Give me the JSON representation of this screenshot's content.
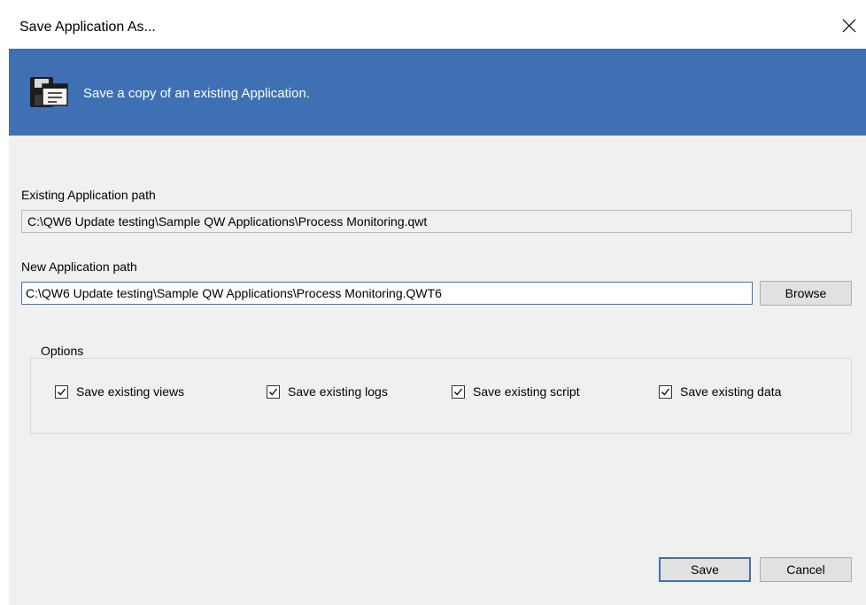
{
  "window": {
    "title": "Save Application As...",
    "close_icon": "close-icon"
  },
  "banner": {
    "icon": "save-application-icon",
    "text": "Save a copy of an existing Application.",
    "background": "#3f70b4"
  },
  "existing_path": {
    "label": "Existing Application path",
    "value": "C:\\QW6 Update testing\\Sample QW Applications\\Process Monitoring.qwt"
  },
  "new_path": {
    "label": "New Application path",
    "value": "C:\\QW6 Update testing\\Sample QW Applications\\Process Monitoring.QWT6",
    "browse_label": "Browse"
  },
  "options": {
    "legend": "Options",
    "items": [
      {
        "label": "Save existing views",
        "checked": true
      },
      {
        "label": "Save existing logs",
        "checked": true
      },
      {
        "label": "Save existing script",
        "checked": true
      },
      {
        "label": "Save existing data",
        "checked": true
      }
    ]
  },
  "footer": {
    "save_label": "Save",
    "cancel_label": "Cancel"
  }
}
